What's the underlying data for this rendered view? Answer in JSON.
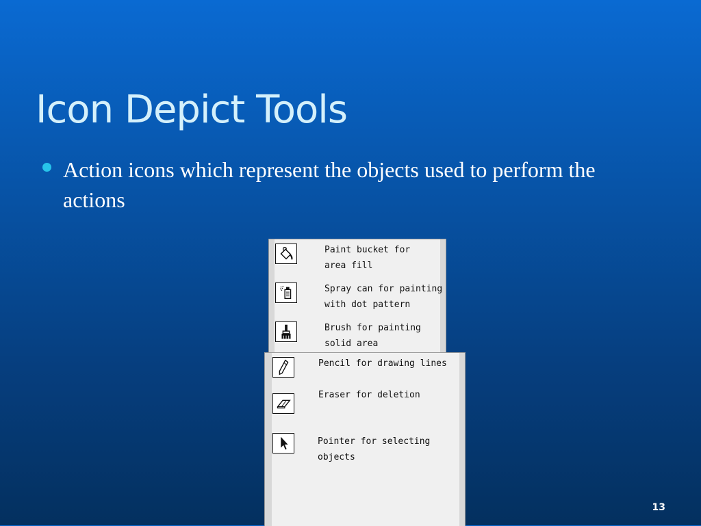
{
  "slide": {
    "title": "Icon Depict Tools",
    "bullet": "Action icons which represent the objects used to perform the actions",
    "page_number": "13"
  },
  "tools_top": [
    {
      "icon": "paint-bucket-icon",
      "line1": "Paint bucket for",
      "line2": "area fill"
    },
    {
      "icon": "spray-can-icon",
      "line1": "Spray can for painting",
      "line2": "with dot pattern"
    },
    {
      "icon": "brush-icon",
      "line1": "Brush for painting",
      "line2": "solid area"
    }
  ],
  "tools_bottom": [
    {
      "icon": "pencil-icon",
      "line1": "Pencil for drawing lines",
      "line2": ""
    },
    {
      "icon": "eraser-icon",
      "line1": "Eraser for deletion",
      "line2": ""
    },
    {
      "icon": "pointer-icon",
      "line1": "Pointer for selecting",
      "line2": "objects"
    }
  ],
  "colors": {
    "background_top": "#0a6ad2",
    "background_bottom": "#04305f",
    "title": "#d4f0fb",
    "bullet": "#27c4ea"
  }
}
